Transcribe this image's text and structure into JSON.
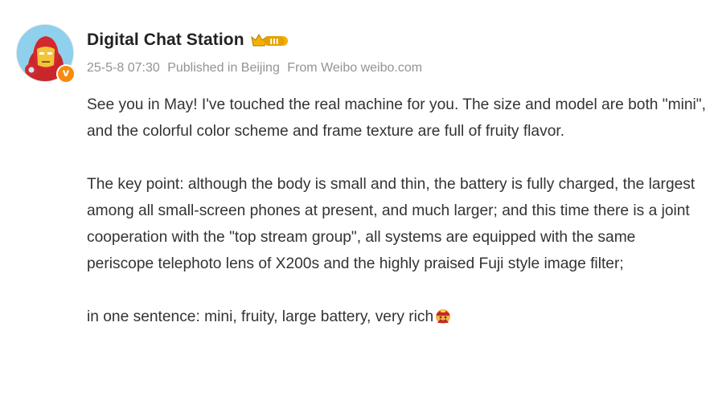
{
  "post": {
    "author": "Digital Chat Station",
    "level_badge": "III",
    "verified_badge": "v",
    "timestamp": "25-5-8 07:30",
    "location": "Published in Beijing",
    "source": "From Weibo weibo.com",
    "paragraphs": [
      "See you in May! I've touched the real machine for you. The size and model are both \"mini\", and the colorful color scheme and frame texture are full of fruity flavor.",
      "The key point: although the body is small and thin, the battery is fully charged, the largest among all small-screen phones at present, and much larger; and this time there is a joint cooperation with the \"top stream group\", all systems are equipped with the same periscope telephoto lens of X200s and the highly praised Fuji style image filter;",
      "in one sentence: mini, fruity, large battery, very rich"
    ],
    "emoji_icon": "rich-face-emoji",
    "colors": {
      "name": "#222222",
      "meta": "#939393",
      "body": "#333333",
      "badge_orange": "#f78b0f",
      "crown_gold": "#f5b300"
    }
  }
}
